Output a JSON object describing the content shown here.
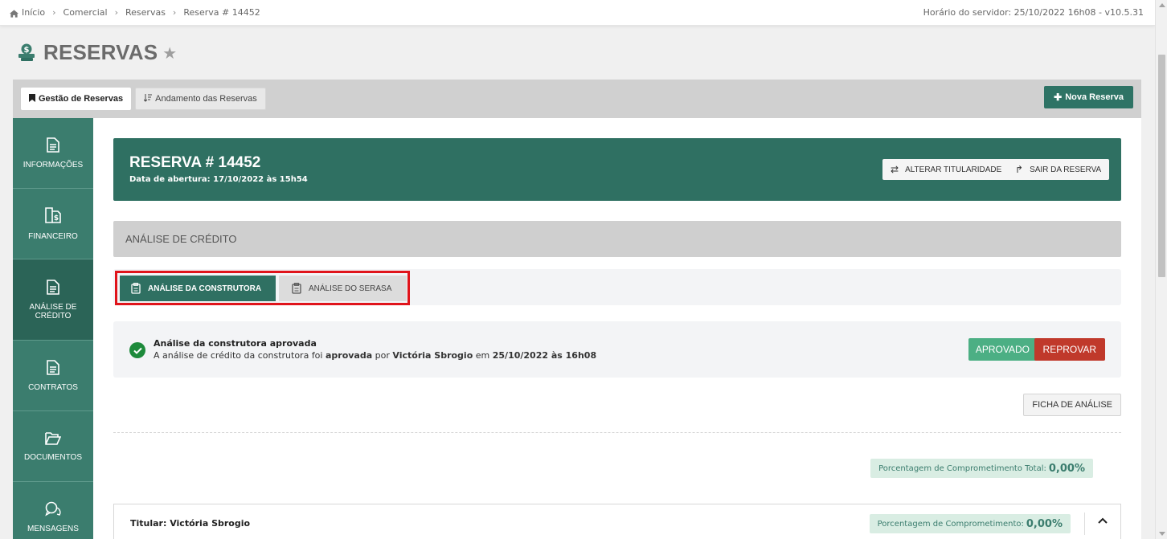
{
  "breadcrumb": {
    "items": [
      "Início",
      "Comercial",
      "Reservas",
      "Reserva # 14452"
    ]
  },
  "server_time": "Horário do servidor: 25/10/2022 16h08 - v10.5.31",
  "page": {
    "title": "RESERVAS"
  },
  "tabs": {
    "gestao": "Gestão de Reservas",
    "andamento": "Andamento das Reservas",
    "nova": "Nova Reserva"
  },
  "sidenav": [
    {
      "label": "INFORMAÇÕES"
    },
    {
      "label": "FINANCEIRO"
    },
    {
      "label": "ANÁLISE DE CRÉDITO"
    },
    {
      "label": "CONTRATOS"
    },
    {
      "label": "DOCUMENTOS"
    },
    {
      "label": "MENSAGENS"
    }
  ],
  "reserva": {
    "title": "RESERVA # 14452",
    "date": "Data de abertura: 17/10/2022 às 15h54",
    "alterar": "ALTERAR TITULARIDADE",
    "sair": "SAIR DA RESERVA"
  },
  "section": {
    "title": "ANÁLISE DE CRÉDITO"
  },
  "subtabs": {
    "construtora": "ANÁLISE DA CONSTRUTORA",
    "serasa": "ANÁLISE DO SERASA"
  },
  "status": {
    "title": "Análise da construtora aprovada",
    "desc_prefix": "A análise de crédito da construtora foi",
    "desc_word": "aprovada",
    "desc_by": "por",
    "user": "Victória Sbrogio",
    "desc_em": "em",
    "datetime": "25/10/2022 às 16h08",
    "approve": "APROVADO",
    "reprove": "REPROVAR"
  },
  "ficha": "FICHA DE ANÁLISE",
  "pct_total": {
    "label": "Porcentagem de Comprometimento Total:",
    "value": "0,00%"
  },
  "titular": {
    "label": "Titular: Victória Sbrogio",
    "pct_label": "Porcentagem de Comprometimento:",
    "pct_value": "0,00%"
  },
  "colors": {
    "brand": "#2f7062",
    "sidebar": "#3b7d6e",
    "danger": "#c0392b",
    "success": "#4caf84",
    "highlight": "#e0141b"
  }
}
